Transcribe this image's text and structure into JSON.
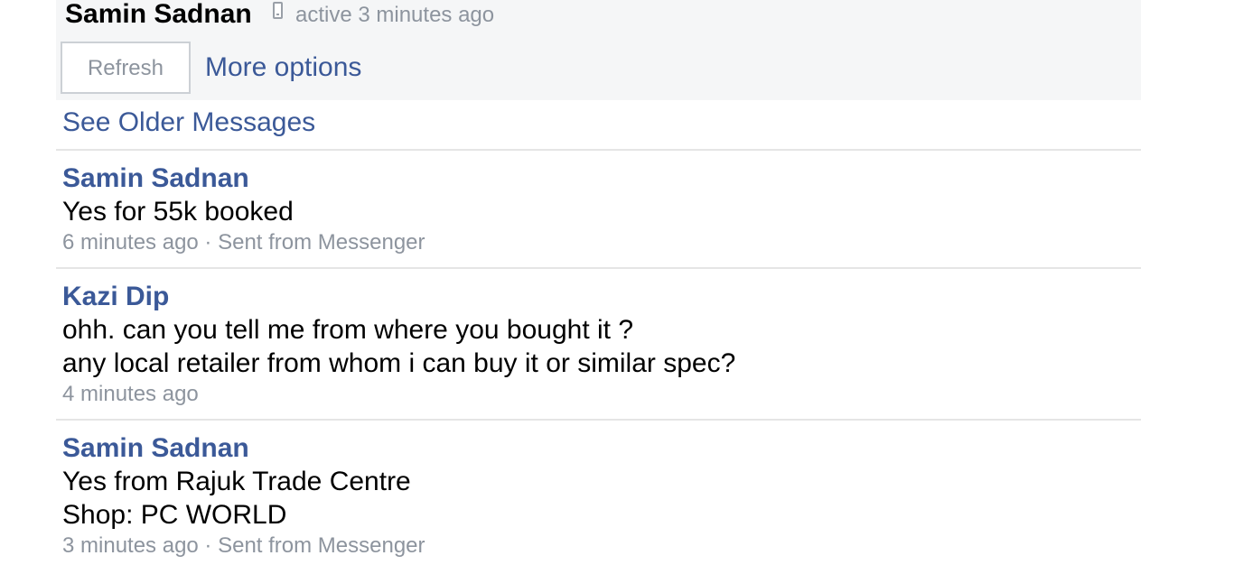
{
  "header": {
    "contact_name": "Samin Sadnan",
    "device_icon": "mobile-phone-icon",
    "active_status": "active 3 minutes ago",
    "refresh_label": "Refresh",
    "more_options_label": "More options"
  },
  "see_older_label": "See Older Messages",
  "messages": [
    {
      "author": "Samin Sadnan",
      "lines": [
        "Yes for 55k booked"
      ],
      "meta": "6 minutes ago · Sent from Messenger"
    },
    {
      "author": "Kazi Dip",
      "lines": [
        "ohh. can you tell me from where you bought it ?",
        "any local retailer from whom i can buy it or similar spec?"
      ],
      "meta": "4 minutes ago"
    },
    {
      "author": "Samin Sadnan",
      "lines": [
        "Yes from Rajuk Trade Centre",
        "Shop: PC WORLD"
      ],
      "meta": "3 minutes ago · Sent from Messenger"
    }
  ],
  "colors": {
    "link": "#3b5998",
    "muted": "#8d949e",
    "header_bg": "#f5f6f7",
    "divider": "#e5e5e5"
  }
}
